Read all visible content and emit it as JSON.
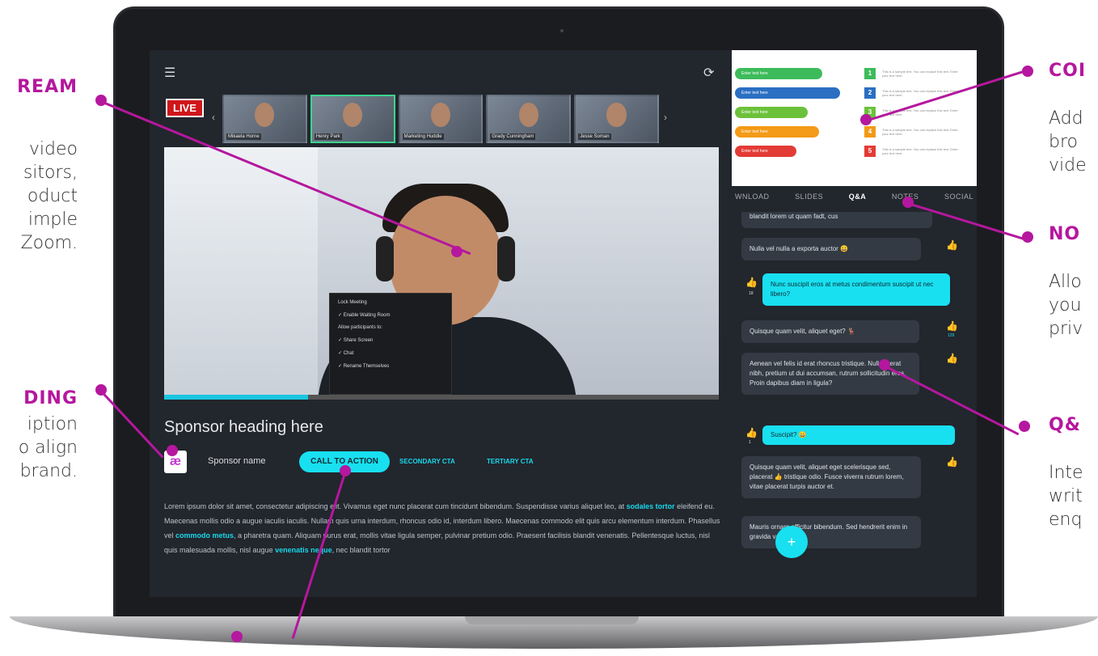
{
  "callouts": {
    "stream": {
      "title": "REAM",
      "lines": [
        "video",
        "sitors,",
        "oduct",
        "imple",
        "Zoom."
      ]
    },
    "branding": {
      "title": "DING",
      "lines": [
        "iption",
        "o align",
        "brand."
      ]
    },
    "content": {
      "title": "COI",
      "lines": [
        "Add",
        "bro",
        "vide"
      ]
    },
    "notes": {
      "title": "NO",
      "lines": [
        "Allo",
        "you",
        "priv"
      ]
    },
    "qa": {
      "title": "Q&",
      "lines": [
        "Inte",
        "writ",
        "enq"
      ]
    }
  },
  "app": {
    "live_badge": "LIVE",
    "menu_icon": "hamburger-icon",
    "refresh_icon": "refresh-icon",
    "participants": [
      "Mikaela Horne",
      "Henry Park",
      "Marketing Huddle",
      "Grady Cunningham",
      "Jesse Soman"
    ],
    "host_menu": {
      "items": [
        "Lock Meeting",
        "✓ Enable Waiting Room",
        "Allow participants to:",
        "✓ Share Screen",
        "✓ Chat",
        "✓ Rename Themselves"
      ]
    },
    "progress_fraction": 0.26,
    "sponsor": {
      "heading": "Sponsor heading here",
      "logo": "æ",
      "name": "Sponsor name",
      "cta_primary": "CALL TO ACTION",
      "cta_secondary": "SECONDARY CTA",
      "cta_tertiary": "TERTIARY CTA",
      "body_parts": [
        "Lorem ipsum dolor sit amet, consectetur adipiscing elit. Vivamus eget nunc placerat cum tincidunt bibendum. Suspendisse varius aliquet leo, at ",
        "sodales tortor",
        " eleifend eu. Maecenas mollis odio a augue iaculis iaculis. Nullam quis urna interdum, rhoncus odio id, interdum libero. Maecenas commodo elit quis arcu elementum interdum. Phasellus vel ",
        "commodo metus",
        ", a pharetra quam. Aliquam purus erat, mollis vitae ligula semper, pulvinar pretium odio. Praesent facilisis blandit venenatis. Pellentesque luctus, nisl quis malesuada mollis, nisl augue ",
        "venenatis neque",
        ", nec blandit tortor"
      ]
    },
    "poll": {
      "options": [
        "Enter text here",
        "Enter text here",
        "Enter text here",
        "Enter text here",
        "Enter text here"
      ],
      "numbers": [
        "1",
        "2",
        "3",
        "4",
        "5"
      ],
      "descriptions": [
        "This is a sample text. You can replace this text. Enter your text here.",
        "This is a sample text. You can replace this text. Enter your text here.",
        "This is a sample text. You can replace this text. Enter your text here.",
        "This is a sample text. You can replace this text. Enter your text here.",
        "This is a sample text. You can replace this text. Enter your text here."
      ],
      "colors": [
        "#3dbb5b",
        "#2a6fc2",
        "#6cc13a",
        "#f39a16",
        "#e33b35"
      ]
    },
    "tabs": [
      "WNLOAD",
      "SLIDES",
      "Q&A",
      "NOTES",
      "SOCIAL"
    ],
    "active_tab": "Q&A",
    "chat": [
      {
        "text": "blandit lorem ut quam fadt, cus",
        "me": false
      },
      {
        "text": "Nulla vel nulla a exporta auctor 😀",
        "me": false
      },
      {
        "text": "Nunc suscipit eros at metus condimentum suscipit ut nec libero?",
        "me": true,
        "votes": "18"
      },
      {
        "text": "Quisque quam velit, aliquet eget? 🦌",
        "me": false,
        "votes": "129"
      },
      {
        "text": "Aenean vel felis id erat rhoncus tristique. Nullam erat nibh, pretium ut dui accumsan, rutrum sollicitudin eros. Proin dapibus diam in ligula?",
        "me": false
      },
      {
        "text": "Suscipit? 😀",
        "me": true,
        "votes": "1"
      },
      {
        "text": "Quisque quam velit, aliquet eget scelerisque sed, placerat 👍 tristique odio. Fusce viverra rutrum lorem, vitae placerat turpis auctor et.",
        "me": false
      },
      {
        "text": "Mauris ornare efficitur bibendum. Sed hendrerit enim in gravida varius.",
        "me": false
      }
    ],
    "fab_label": "+"
  }
}
